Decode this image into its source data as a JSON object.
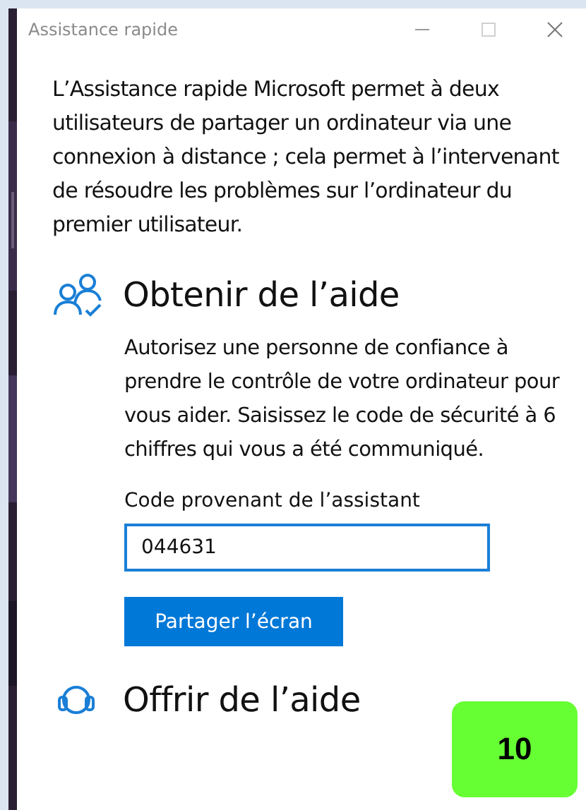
{
  "window": {
    "title": "Assistance rapide"
  },
  "intro": "L’Assistance rapide Microsoft permet à deux utilisateurs de partager un ordinateur via une connexion à distance ; cela permet à l’intervenant de résoudre les problèmes sur l’ordinateur du premier utilisateur.",
  "sections": [
    {
      "kind": "get",
      "heading": "Obtenir de l’aide",
      "description": "Autorisez une personne de confiance à prendre le contrôle de votre ordinateur pour vous aider. Saisissez le code de sécurité à 6 chiffres qui vous a été communiqué.",
      "field_label": "Code provenant de l’assistant",
      "field_value": "044631",
      "button": "Partager l’écran"
    },
    {
      "kind": "give",
      "heading": "Offrir de l’aide"
    }
  ],
  "badge": "10"
}
